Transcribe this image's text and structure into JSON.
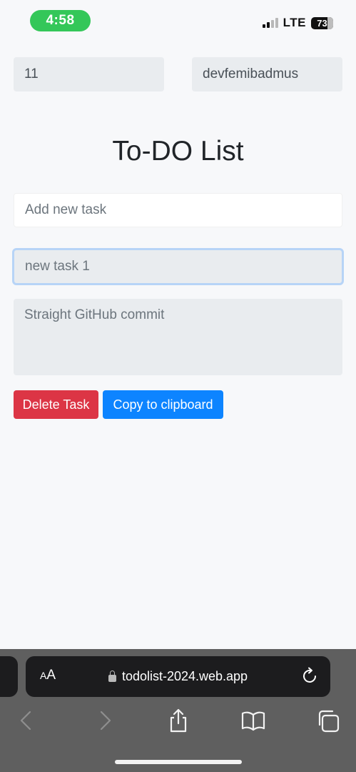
{
  "status_bar": {
    "time": "4:58",
    "network": "LTE",
    "battery": "73",
    "battery_level": 0.73
  },
  "fields": {
    "task_id": "11",
    "username": "devfemibadmus"
  },
  "page_title": "To-DO List",
  "new_task_input": {
    "placeholder": "Add new task",
    "value": ""
  },
  "task_title_field": {
    "placeholder": "new task 1"
  },
  "task_description": {
    "text": "Straight GitHub commit"
  },
  "buttons": {
    "delete_label": "Delete Task",
    "copy_label": "Copy to clipboard"
  },
  "browser": {
    "text_size_label": "AA",
    "url": "todolist-2024.web.app"
  },
  "colors": {
    "danger": "#dc3545",
    "primary": "#0d84ff",
    "time_pill": "#34c759"
  },
  "icons": [
    "signal-icon",
    "battery-icon",
    "lock-icon",
    "reload-icon",
    "back-icon",
    "forward-icon",
    "share-icon",
    "bookmarks-icon",
    "tabs-icon"
  ]
}
